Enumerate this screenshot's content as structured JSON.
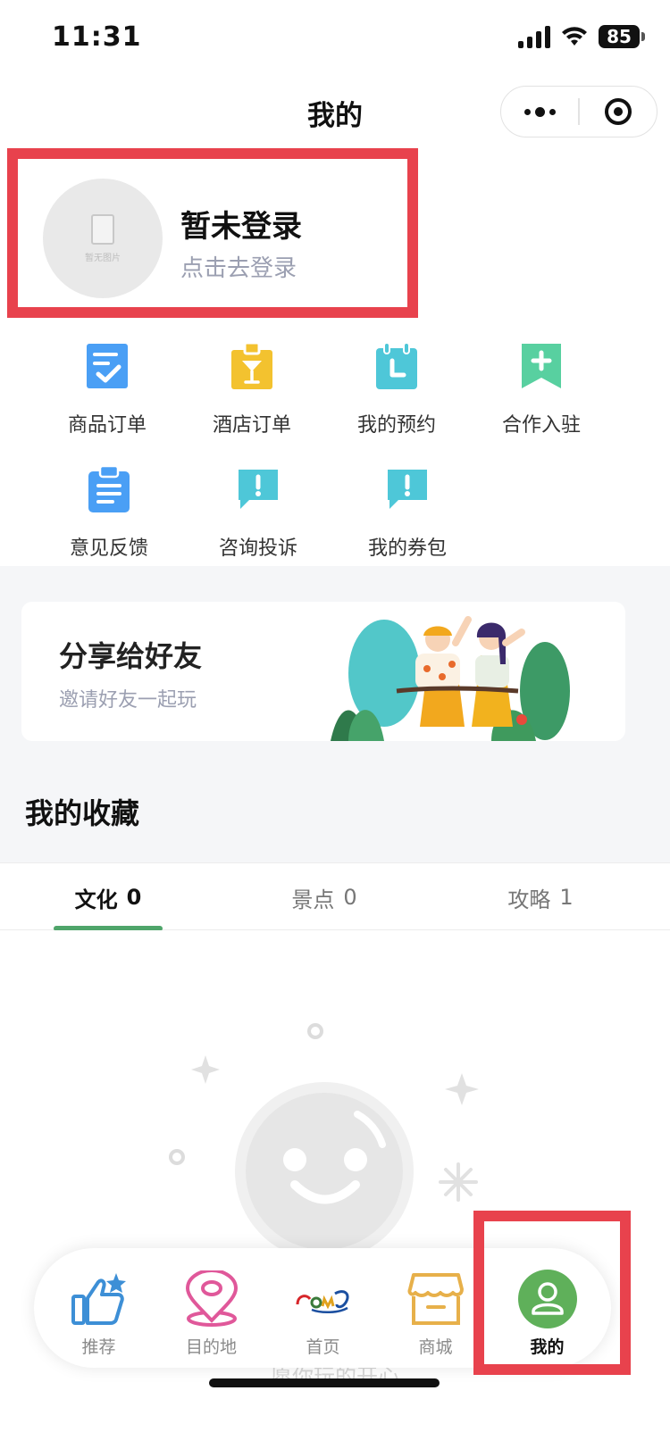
{
  "status_bar": {
    "time": "11:31",
    "battery": "85"
  },
  "nav": {
    "title": "我的",
    "more_icon": "more-dots-icon",
    "close_icon": "target-circle-icon"
  },
  "profile": {
    "avatar_placeholder": "暂无图片",
    "title": "暂未登录",
    "subtitle": "点击去登录"
  },
  "functions": [
    {
      "label": "商品订单",
      "icon": "order-check-icon",
      "color": "#4a9ff5"
    },
    {
      "label": "酒店订单",
      "icon": "hotel-cocktail-icon",
      "color": "#f3c22f"
    },
    {
      "label": "我的预约",
      "icon": "calendar-clock-icon",
      "color": "#4ec7d8"
    },
    {
      "label": "合作入驻",
      "icon": "bookmark-plus-icon",
      "color": "#58d0a0"
    },
    {
      "label": "意见反馈",
      "icon": "clipboard-icon",
      "color": "#4a9ff5"
    },
    {
      "label": "咨询投诉",
      "icon": "chat-alert-icon",
      "color": "#4ec7d8"
    },
    {
      "label": "我的券包",
      "icon": "chat-alert-icon",
      "color": "#4ec7d8"
    }
  ],
  "share": {
    "title": "分享给好友",
    "subtitle": "邀请好友一起玩"
  },
  "favorites": {
    "title": "我的收藏",
    "tabs": [
      {
        "label": "文化",
        "count": "0",
        "active": true
      },
      {
        "label": "景点",
        "count": "0",
        "active": false
      },
      {
        "label": "攻略",
        "count": "1",
        "active": false
      }
    ],
    "empty_hint": "愿你玩的开心"
  },
  "tabbar": [
    {
      "label": "推荐",
      "icon": "thumbs-up-star-icon",
      "active": false
    },
    {
      "label": "目的地",
      "icon": "map-pin-icon",
      "active": false
    },
    {
      "label": "首页",
      "icon": "brand-logo-icon",
      "active": false
    },
    {
      "label": "商城",
      "icon": "store-icon",
      "active": false
    },
    {
      "label": "我的",
      "icon": "user-icon",
      "active": true
    }
  ],
  "colors": {
    "highlight": "#e8424d",
    "accent": "#4fa56a",
    "muted_text": "#9b9fb1"
  }
}
